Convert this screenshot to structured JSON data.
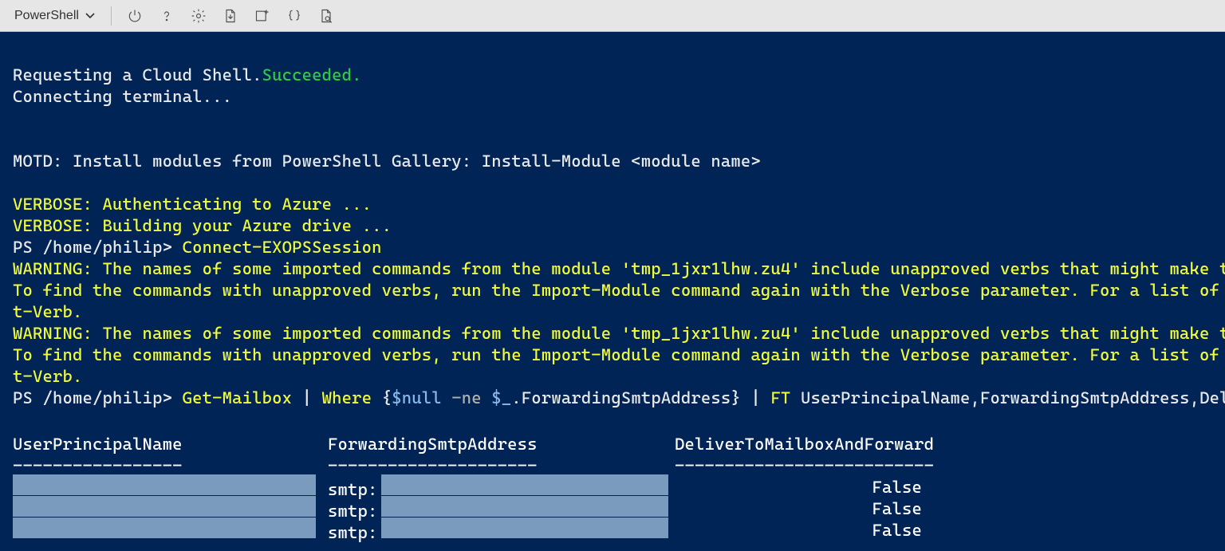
{
  "toolbar": {
    "shell_label": "PowerShell"
  },
  "terminal": {
    "line1_a": "Requesting a Cloud Shell.",
    "line1_b": "Succeeded.",
    "line2": "Connecting terminal...",
    "motd": "MOTD: Install modules from PowerShell Gallery: Install-Module <module name>",
    "verbose1": "VERBOSE: Authenticating to Azure ...",
    "verbose2": "VERBOSE: Building your Azure drive ...",
    "prompt1_prefix": "PS /home/philip> ",
    "prompt1_cmd": "Connect-EXOPSSession",
    "warn1": "WARNING: The names of some imported commands from the module 'tmp_1jxr1lhw.zu4' include unapproved verbs that might make the",
    "warn1b": "To find the commands with unapproved verbs, run the Import-Module command again with the Verbose parameter. For a list of ap",
    "warn1c": "t-Verb.",
    "warn2": "WARNING: The names of some imported commands from the module 'tmp_1jxr1lhw.zu4' include unapproved verbs that might make the",
    "warn2b": "To find the commands with unapproved verbs, run the Import-Module command again with the Verbose parameter. For a list of ap",
    "warn2c": "t-Verb.",
    "prompt2_prefix": "PS /home/philip> ",
    "cmd2_a": "Get-Mailbox",
    "cmd2_pipe1": " | ",
    "cmd2_b": "Where",
    "cmd2_brace_open": " {",
    "cmd2_c": "$null",
    "cmd2_op": " -ne ",
    "cmd2_d": "$_",
    "cmd2_e": ".ForwardingSmtpAddress} | ",
    "cmd2_f": "FT",
    "cmd2_g": " UserPrincipalName,ForwardingSmtpAddress,Deli"
  },
  "table": {
    "headers": [
      "UserPrincipalName",
      "ForwardingSmtpAddress",
      "DeliverToMailboxAndForward"
    ],
    "dashes": [
      "-----------------",
      "---------------------",
      "--------------------------"
    ],
    "rows": [
      {
        "smtp_prefix": "smtp:",
        "deliver": "False"
      },
      {
        "smtp_prefix": "smtp:",
        "deliver": "False"
      },
      {
        "smtp_prefix": "smtp:",
        "deliver": "False"
      }
    ]
  }
}
